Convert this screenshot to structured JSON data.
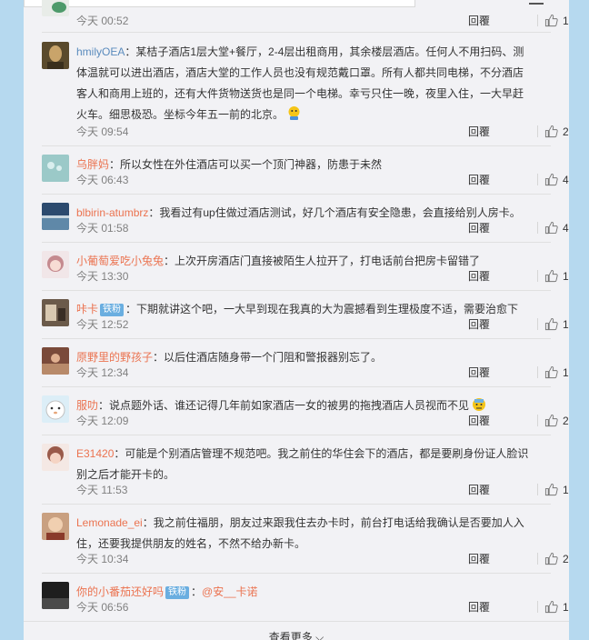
{
  "ui": {
    "reply_label": "回覆",
    "see_more_label": "查看更多",
    "fan_badge": "铁粉"
  },
  "comments": [
    {
      "time": "今天 00:52",
      "likes": "1"
    },
    {
      "name": "hmilyOEA",
      "text": "：某桔子酒店1层大堂+餐厅，2-4层出租商用，其余楼层酒店。任何人不用扫码、测体温就可以进出酒店，酒店大堂的工作人员也没有规范戴口罩。所有人都共同电梯，不分酒店客人和商用上班的，还有大件货物送货也是同一个电梯。幸亏只住一晚，夜里入住，一大早赶火车。细思极恐。坐标今年五一前的北京。",
      "time": "今天 09:54",
      "likes": "2"
    },
    {
      "name": "乌胖妈",
      "text": "：所以女性在外住酒店可以买一个顶门神器，防患于未然",
      "time": "今天 06:43",
      "likes": "4"
    },
    {
      "name": "blbirin-atumbrz",
      "text": "：我看过有up住做过酒店测试，好几个酒店有安全隐患，会直接给别人房卡。",
      "time": "今天 01:58",
      "likes": "4"
    },
    {
      "name": "小葡萄爱吃小兔兔",
      "text": "：上次开房酒店门直接被陌生人拉开了，打电话前台把房卡留错了",
      "time": "今天 13:30",
      "likes": "1"
    },
    {
      "name": "咔卡",
      "text": "：下期就讲这个吧，一大早到现在我真的大为震撼看到生理极度不适，需要治愈下",
      "time": "今天 12:52",
      "likes": "1"
    },
    {
      "name": "原野里的野孩子",
      "text": "：以后住酒店随身带一个门阻和警报器别忘了。",
      "time": "今天 12:34",
      "likes": "1"
    },
    {
      "name": "服叻",
      "text": "：说点题外话、谁还记得几年前如家酒店一女的被男的拖拽酒店人员视而不见",
      "time": "今天 12:09",
      "likes": "2"
    },
    {
      "name": "E31420",
      "text": "：可能是个别酒店管理不规范吧。我之前住的华住会下的酒店，都是要刷身份证人脸识别之后才能开卡的。",
      "time": "今天 11:53",
      "likes": "1"
    },
    {
      "name": "Lemonade_ei",
      "text": "：我之前住福朋，朋友过来跟我住去办卡时，前台打电话给我确认是否要加人入住，还要我提供朋友的姓名，不然不给办新卡。",
      "time": "今天 10:34",
      "likes": "2"
    },
    {
      "name": "你的小番茄还好吗",
      "text": "：",
      "mention": "@安__卡诺",
      "time": "今天 06:56",
      "likes": "1"
    }
  ]
}
